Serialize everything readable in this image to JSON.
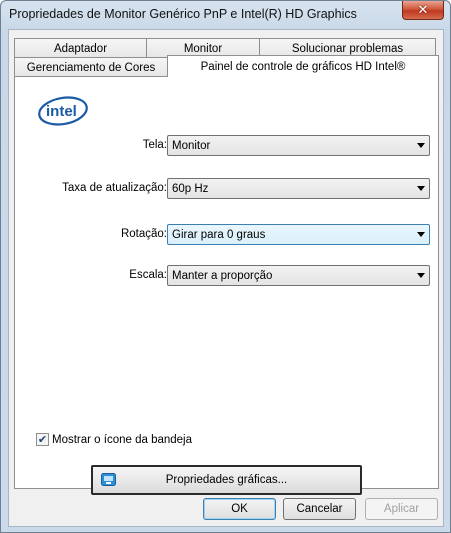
{
  "window": {
    "title": "Propriedades de Monitor Genérico PnP e Intel(R) HD Graphics",
    "close_symbol": "✕"
  },
  "tabs": {
    "row_back": [
      {
        "label": "Adaptador"
      },
      {
        "label": "Monitor"
      },
      {
        "label": "Solucionar problemas"
      }
    ],
    "row_front": [
      {
        "label": "Gerenciamento de Cores"
      },
      {
        "label": "Painel de controle de gráficos HD Intel®"
      }
    ]
  },
  "panel": {
    "logo_text": "intel",
    "fields": {
      "tela": {
        "label": "Tela:",
        "value": "Monitor"
      },
      "taxa": {
        "label": "Taxa de atualização:",
        "value": "60p Hz"
      },
      "rotacao": {
        "label": "Rotação:",
        "value": "Girar para 0 graus"
      },
      "escala": {
        "label": "Escala:",
        "value": "Manter a proporção"
      }
    },
    "tray_checkbox": {
      "label": "Mostrar o ícone da bandeja",
      "checked": true,
      "check_symbol": "✔"
    },
    "graphics_button": {
      "label": "Propriedades gráficas..."
    }
  },
  "footer": {
    "ok": "OK",
    "cancel": "Cancelar",
    "apply": "Aplicar"
  },
  "icons": {
    "dropdown": "chevron-down-icon",
    "close": "close-icon",
    "logo": "intel-logo",
    "graphics": "intel-graphics-icon"
  }
}
